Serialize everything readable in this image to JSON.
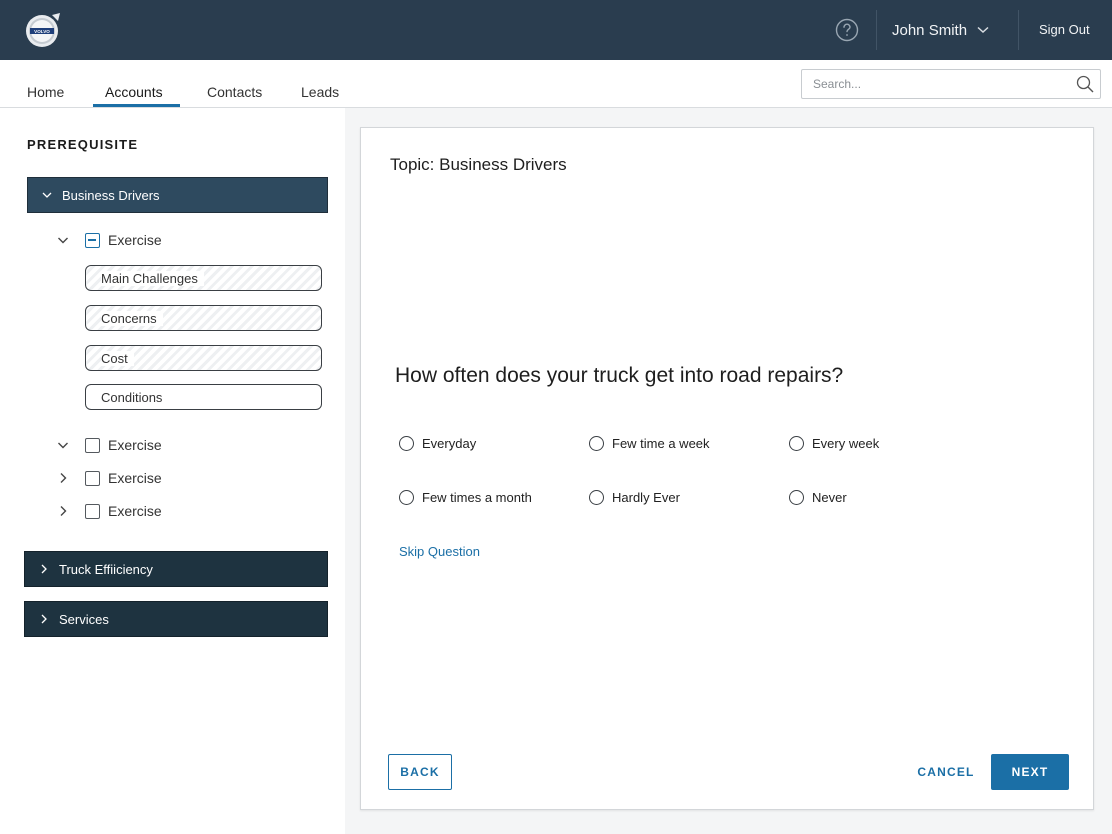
{
  "header": {
    "logo_icon": "volvo-logo-icon",
    "help_icon": "question-circle-icon",
    "user_name": "John Smith",
    "sign_out": "Sign Out"
  },
  "nav": {
    "tabs": [
      {
        "label": "Home",
        "active": false
      },
      {
        "label": "Accounts",
        "active": true
      },
      {
        "label": "Contacts",
        "active": false
      },
      {
        "label": "Leads",
        "active": false
      }
    ],
    "search_placeholder": "Search..."
  },
  "sidebar": {
    "title": "PREREQUISITE",
    "sections": [
      {
        "label": "Business Drivers",
        "expanded": true
      },
      {
        "label": "Truck Effiiciency",
        "expanded": false
      },
      {
        "label": "Services",
        "expanded": false
      }
    ],
    "exercises": [
      {
        "label": "Exercise",
        "expanded": true,
        "state": "indeterminate"
      },
      {
        "label": "Exercise",
        "expanded": true,
        "state": "unchecked"
      },
      {
        "label": "Exercise",
        "expanded": false,
        "state": "unchecked"
      },
      {
        "label": "Exercise",
        "expanded": false,
        "state": "unchecked"
      }
    ],
    "sub_items": [
      {
        "label": "Main Challenges",
        "status": "in-progress"
      },
      {
        "label": "Concerns",
        "status": "in-progress"
      },
      {
        "label": "Cost",
        "status": "in-progress"
      },
      {
        "label": "Conditions",
        "status": "not-started"
      }
    ]
  },
  "main": {
    "topic": "Topic: Business Drivers",
    "question": "How often does your truck get into road repairs?",
    "options": [
      "Everyday",
      "Few time a week",
      "Every week",
      "Few times a month",
      "Hardly Ever",
      "Never"
    ],
    "skip_label": "Skip Question",
    "back_label": "BACK",
    "cancel_label": "CANCEL",
    "next_label": "NEXT"
  },
  "colors": {
    "header_bg": "#2a3d4f",
    "accent": "#1b6fa6",
    "section_active": "#2e4a5f",
    "section_collapsed": "#1e3340"
  }
}
